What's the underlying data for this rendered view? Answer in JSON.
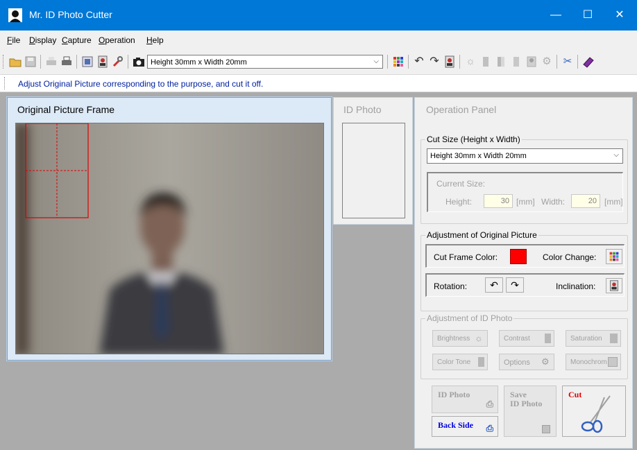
{
  "window": {
    "title": "Mr. ID Photo Cutter",
    "minimize": "—",
    "maximize": "☐",
    "close": "✕"
  },
  "menu": {
    "items": [
      {
        "label": "File",
        "hotkey": "F",
        "rest": "ile"
      },
      {
        "label": "Display",
        "hotkey": "D",
        "rest": "isplay"
      },
      {
        "label": "Capture",
        "hotkey": "C",
        "rest": "apture"
      },
      {
        "label": "Operation",
        "hotkey": "O",
        "rest": "peration"
      },
      {
        "label": "Help",
        "hotkey": "H",
        "rest": "elp"
      }
    ]
  },
  "toolbar": {
    "size_combo_value": "Height 30mm x Width 20mm"
  },
  "info_message": "Adjust Original Picture corresponding to the purpose, and cut it off.",
  "original_frame": {
    "title": "Original Picture Frame",
    "cut_frame_color": "#e00000"
  },
  "id_photo_frame": {
    "title": "ID Photo"
  },
  "operation_panel": {
    "title": "Operation Panel",
    "cut_size": {
      "group_label": "Cut Size (Height x Width)",
      "selected": "Height 30mm x Width 20mm",
      "current_size_label": "Current Size:",
      "height_label": "Height:",
      "height_value": "30",
      "unit1": "[mm]",
      "width_label": "Width:",
      "width_value": "20",
      "unit2": "[mm]"
    },
    "adjust_original": {
      "group_label": "Adjustment of Original Picture",
      "cut_frame_color_label": "Cut Frame Color:",
      "color_change_label": "Color Change:",
      "rotation_label": "Rotation:",
      "inclination_label": "Inclination:",
      "frame_color": "#ff0000"
    },
    "adjust_id": {
      "group_label": "Adjustment of ID Photo",
      "brightness": "Brightness",
      "contrast": "Contrast",
      "saturation": "Saturation",
      "color_tone": "Color Tone",
      "options": "Options",
      "monochrome": "Monochrom"
    },
    "actions": {
      "id_photo_print": "ID Photo",
      "back_side": "Back Side",
      "save_line1": "Save",
      "save_line2": "ID Photo",
      "cut": "Cut"
    }
  }
}
